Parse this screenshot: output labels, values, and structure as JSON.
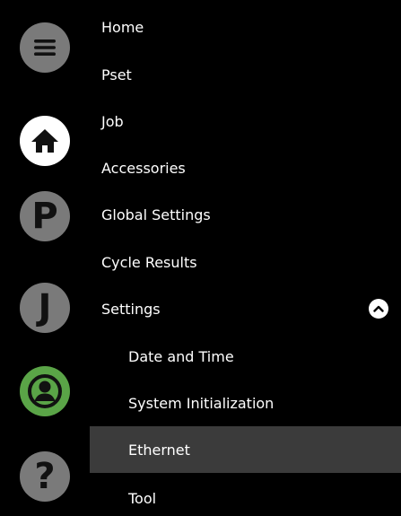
{
  "rail": {
    "icons": [
      "hamburger-menu-icon",
      "home-icon",
      "pset-icon",
      "job-icon",
      "user-icon",
      "help-icon"
    ],
    "pset_letter": "P",
    "job_letter": "J",
    "help_glyph": "?"
  },
  "menu": {
    "home": "Home",
    "pset": "Pset",
    "job": "Job",
    "accessories": "Accessories",
    "global_settings": "Global Settings",
    "cycle_results": "Cycle Results",
    "settings": "Settings",
    "date_and_time": "Date and Time",
    "system_initialization": "System Initialization",
    "ethernet": "Ethernet",
    "tool": "Tool"
  },
  "colors": {
    "background": "#000000",
    "icon_gray": "#7a7a7a",
    "user_green": "#5aa447",
    "active_row": "#3b3b3b",
    "text": "#ffffff"
  }
}
